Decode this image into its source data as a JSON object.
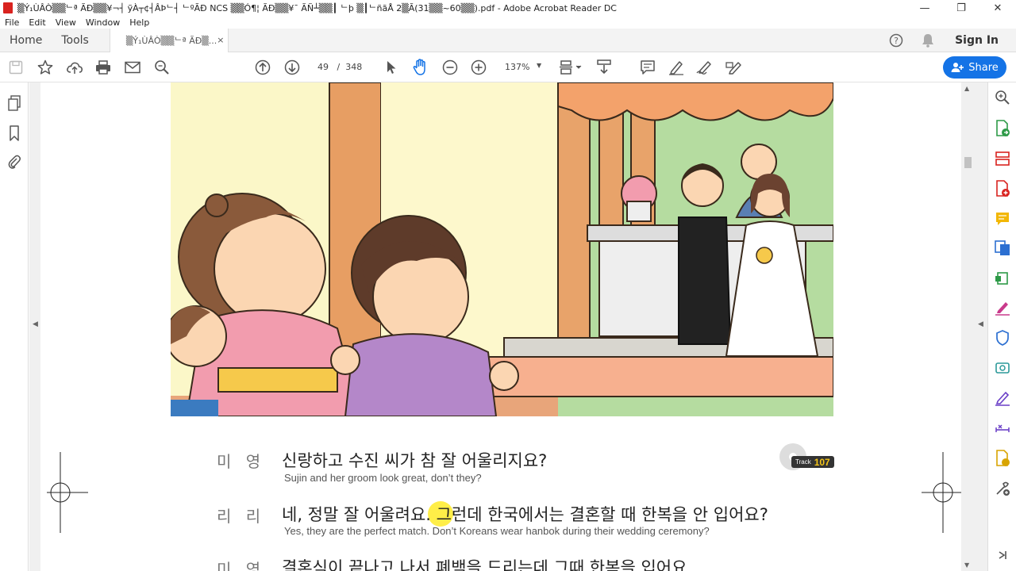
{
  "window": {
    "title": "▒Ý₁ÙÂÒ▒▒ᄂª ÃÐ▒▒¥¬┤ ỹÀ┬¢┤ÂÞᄂ┤ ᄂºÃÐ NCS ▒▒Ó¶¦ ÃÐ▒▒¥¯ ÃÑ┴▒▒┃ ᄂþ ▒┃ᄂñãÅ 2▒Ã(31▒▒~60▒▒).pdf - Adobe Acrobat Reader DC",
    "minimize": "—",
    "restore": "❐",
    "close": "✕"
  },
  "menu": [
    "File",
    "Edit",
    "View",
    "Window",
    "Help"
  ],
  "tabs": {
    "home": "Home",
    "tools": "Tools",
    "document": "▒Ý₁ÙÂÒ▒▒ᄂª ÃÐ▒...",
    "document_close": "×"
  },
  "header": {
    "sign_in": "Sign In"
  },
  "toolbar": {
    "current_page": "49",
    "page_separator": "/",
    "total_pages": "348",
    "zoom": "137%",
    "share_label": "Share"
  },
  "document": {
    "track": {
      "label": "Track",
      "number": "107"
    },
    "dialogue": [
      {
        "speaker": "미 영",
        "korean": "신랑하고 수진 씨가 참 잘 어울리지요?",
        "english": "Sujin and her groom look great, don’t they?"
      },
      {
        "speaker": "리 리",
        "korean": "네, 정말 잘 어울려요. 그런데 한국에서는 결혼할 때 한복을 안 입어요?",
        "english": "Yes, they are the perfect match. Don’t Koreans wear hanbok during their wedding ceremony?"
      },
      {
        "speaker": "미 영",
        "korean": "결혼식이 끝나고 나서 폐백을 드리는데 그때 한복을 입어요.",
        "english": ""
      }
    ]
  },
  "colors": {
    "accent": "#1473e6",
    "acrobat_red": "#d9231f",
    "track_yellow": "#f5c518"
  }
}
